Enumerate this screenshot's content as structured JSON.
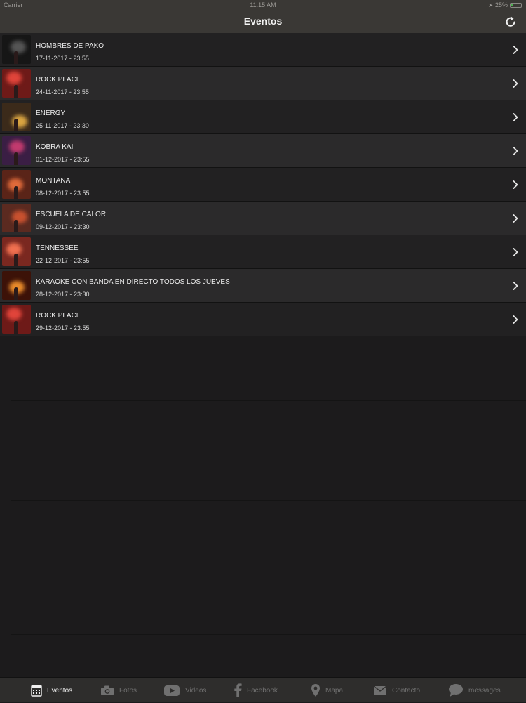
{
  "status": {
    "carrier": "Carrier",
    "time": "11:15 AM",
    "battery": "25%",
    "battery_level": 0.25,
    "battery_color": "#4caf50"
  },
  "nav": {
    "title": "Eventos",
    "refresh_icon": "refresh-icon"
  },
  "events": [
    {
      "title": "HOMBRES DE PAKO",
      "date": "17-11-2017 - 23:55"
    },
    {
      "title": "ROCK PLACE",
      "date": "24-11-2017 - 23:55"
    },
    {
      "title": "ENERGY",
      "date": "25-11-2017 - 23:30"
    },
    {
      "title": "KOBRA KAI",
      "date": "01-12-2017 - 23:55"
    },
    {
      "title": "MONTANA",
      "date": "08-12-2017 - 23:55"
    },
    {
      "title": "ESCUELA DE CALOR",
      "date": "09-12-2017 - 23:30"
    },
    {
      "title": "TENNESSEE",
      "date": "22-12-2017 - 23:55"
    },
    {
      "title": "KARAOKE CON BANDA EN DIRECTO TODOS LOS JUEVES",
      "date": "28-12-2017 - 23:30"
    },
    {
      "title": "ROCK PLACE",
      "date": "29-12-2017 - 23:55"
    }
  ],
  "tabs": [
    {
      "label": "Eventos",
      "icon": "calendar-icon",
      "active": true
    },
    {
      "label": "Fotos",
      "icon": "camera-icon",
      "active": false
    },
    {
      "label": "Videos",
      "icon": "youtube-icon",
      "active": false
    },
    {
      "label": "Facebook",
      "icon": "facebook-icon",
      "active": false
    },
    {
      "label": "Mapa",
      "icon": "map-pin-icon",
      "active": false
    },
    {
      "label": "Contacto",
      "icon": "envelope-icon",
      "active": false
    },
    {
      "label": "messages",
      "icon": "chat-bubble-icon",
      "active": false
    }
  ],
  "colors": {
    "background": "#1c1b1c",
    "bar": "#3a3835",
    "row_odd": "#222122",
    "row_even": "#2b2a2b",
    "tab_active": "#f0f0f0",
    "tab_inactive": "#707070"
  }
}
